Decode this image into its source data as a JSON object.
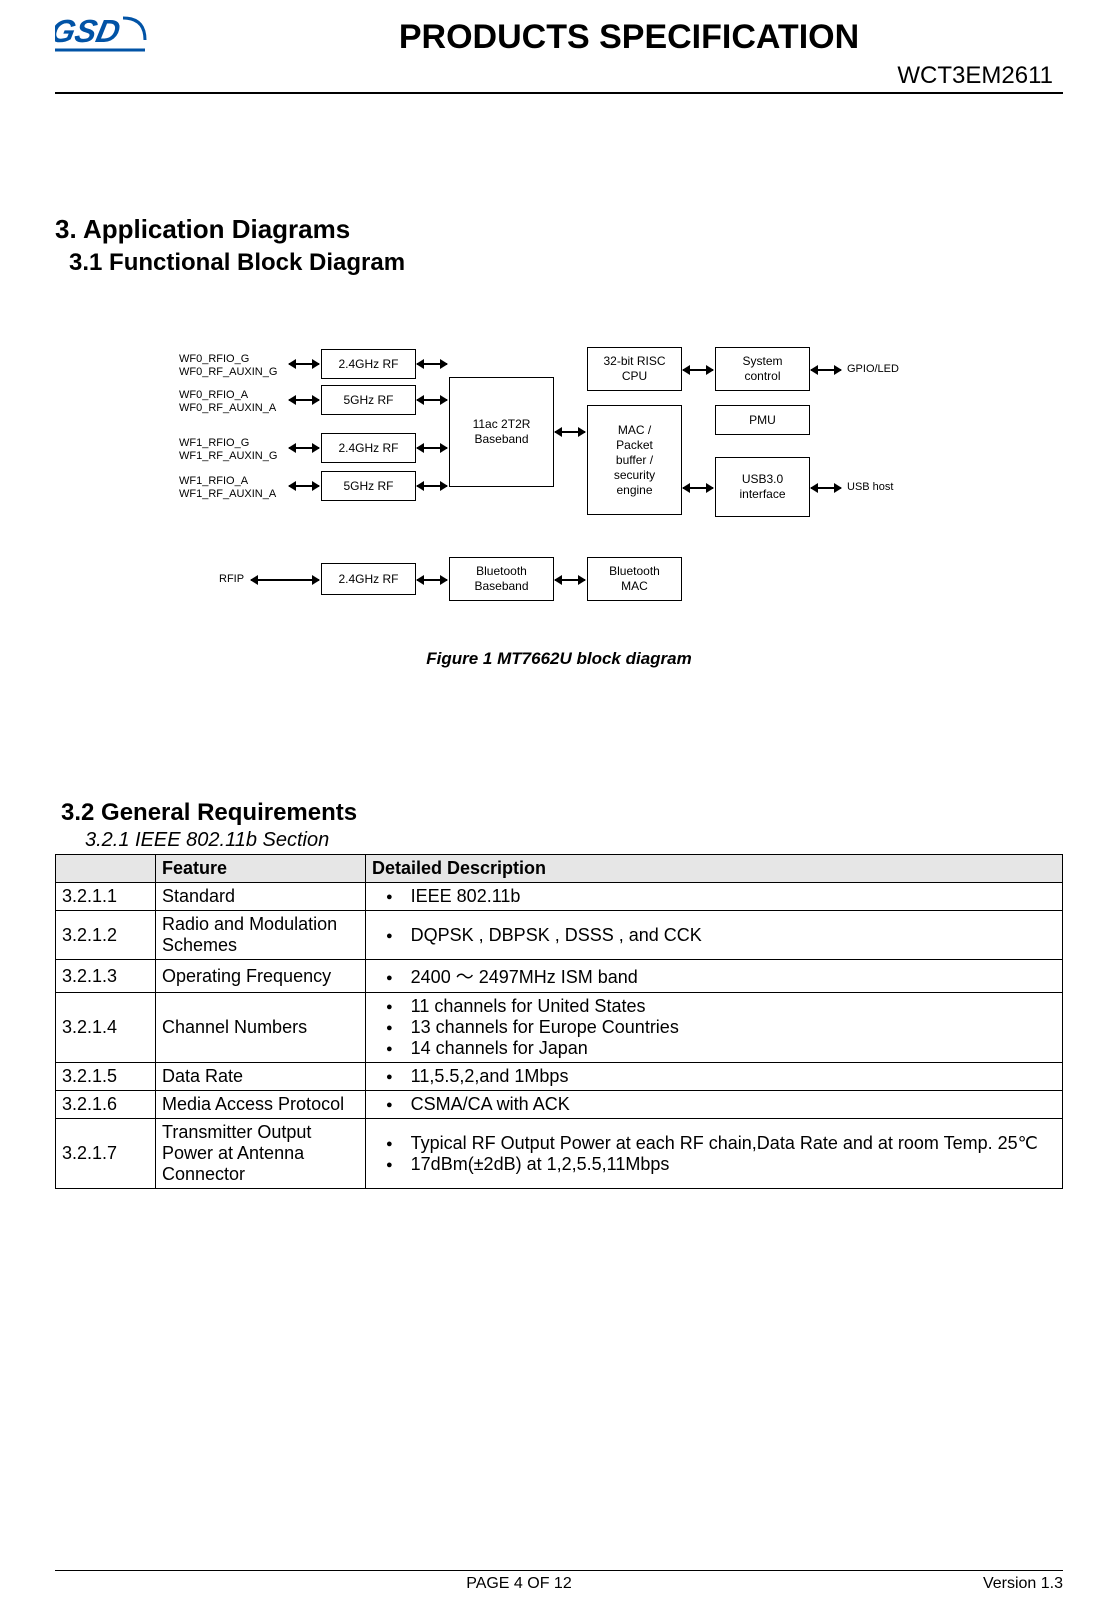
{
  "header": {
    "title": "PRODUCTS SPECIFICATION",
    "part_number": "WCT3EM2611"
  },
  "section3": {
    "title": "3.  Application Diagrams",
    "sub31": "3.1    Functional Block Diagram"
  },
  "diagram": {
    "caption": "Figure 1 MT7662U block diagram",
    "left_labels": {
      "g0": "WF0_RFIO_G\nWF0_RF_AUXIN_G",
      "a0": "WF0_RFIO_A\nWF0_RF_AUXIN_A",
      "g1": "WF1_RFIO_G\nWF1_RF_AUXIN_G",
      "a1": "WF1_RFIO_A\nWF1_RF_AUXIN_A",
      "rfip": "RFIP"
    },
    "rf_blocks": {
      "rf0_24": "2.4GHz RF",
      "rf0_5": "5GHz RF",
      "rf1_24": "2.4GHz RF",
      "rf1_5": "5GHz RF",
      "bt_rf": "2.4GHz RF"
    },
    "mid_blocks": {
      "baseband": "11ac 2T2R\nBaseband",
      "bt_baseband": "Bluetooth\nBaseband"
    },
    "mac_blocks": {
      "cpu": "32-bit RISC\nCPU",
      "mac": "MAC /\nPacket\nbuffer /\nsecurity\nengine",
      "bt_mac": "Bluetooth\nMAC"
    },
    "right_blocks": {
      "sys": "System\ncontrol",
      "pmu": "PMU",
      "usb": "USB3.0\ninterface"
    },
    "right_labels": {
      "gpio": "GPIO/LED",
      "usb_host": "USB host"
    }
  },
  "req": {
    "heading": "3.2 General Requirements",
    "subheading": "3.2.1   IEEE 802.11b Section",
    "th_feature": "Feature",
    "th_desc": "Detailed Description",
    "th_blank": "",
    "rows": [
      {
        "num": "3.2.1.1",
        "feature": "Standard",
        "desc": [
          "IEEE 802.11b"
        ]
      },
      {
        "num": "3.2.1.2",
        "feature": "Radio and Modulation Schemes",
        "desc": [
          "DQPSK , DBPSK , DSSS , and CCK"
        ]
      },
      {
        "num": "3.2.1.3",
        "feature": "Operating Frequency",
        "desc": [
          "2400 ～ 2497MHz ISM band"
        ]
      },
      {
        "num": "3.2.1.4",
        "feature": "Channel Numbers",
        "desc": [
          "11 channels for United States",
          "13 channels for Europe Countries",
          "14 channels for Japan"
        ]
      },
      {
        "num": "3.2.1.5",
        "feature": "Data Rate",
        "desc": [
          "11,5.5,2,and 1Mbps"
        ]
      },
      {
        "num": "3.2.1.6",
        "feature": "Media Access Protocol",
        "desc": [
          "CSMA/CA with ACK"
        ]
      },
      {
        "num": "3.2.1.7",
        "feature": "Transmitter Output Power at Antenna Connector",
        "desc": [
          "Typical RF Output Power at each RF chain,Data Rate and at room Temp. 25℃",
          "17dBm(±2dB) at 1,2,5.5,11Mbps"
        ]
      }
    ]
  },
  "footer": {
    "page": "PAGE   4   OF   12",
    "version": "Version  1.3"
  }
}
